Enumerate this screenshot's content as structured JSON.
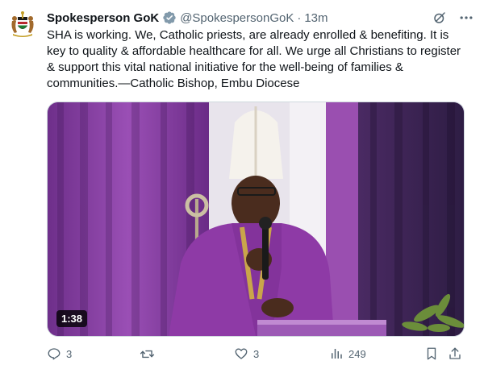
{
  "tweet": {
    "author_name": "Spokesperson GoK",
    "handle": "@SpokespersonGoK",
    "separator": "·",
    "time": "13m",
    "text": "SHA is working. We, Catholic priests, are already enrolled & benefiting. It is key to quality & affordable healthcare for all. We urge all Christians to register & support this vital national initiative for the well-being of families & communities.—Catholic Bishop, Embu Diocese",
    "video": {
      "duration": "1:38"
    },
    "actions": {
      "reply_count": "3",
      "repost_count": "",
      "like_count": "3",
      "views_count": "249"
    }
  },
  "icons": {
    "avatar": "kenya-coat-of-arms",
    "verified": "verified-badge",
    "grok": "grok-icon",
    "more": "more-icon",
    "reply": "reply-icon",
    "repost": "repost-icon",
    "like": "like-icon",
    "views": "views-icon",
    "bookmark": "bookmark-icon",
    "share": "share-icon"
  },
  "colors": {
    "text_primary": "#0f1419",
    "text_secondary": "#536471",
    "verified_badge": "#829aab",
    "vestment_purple": "#8e3aa6"
  }
}
